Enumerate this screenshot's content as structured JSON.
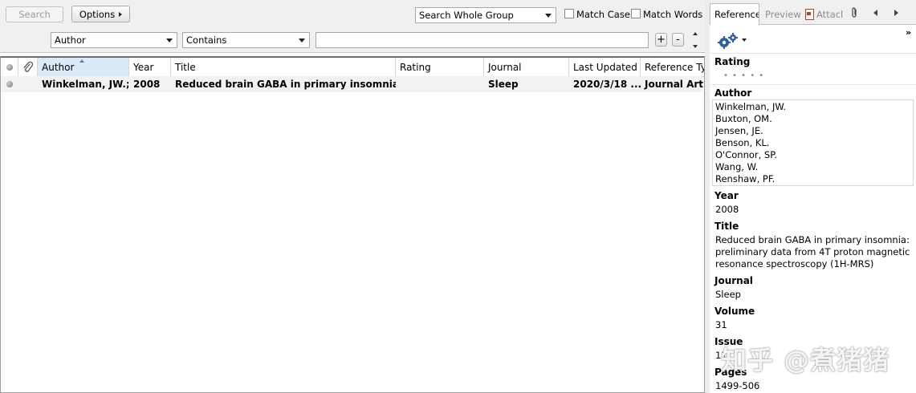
{
  "search": {
    "search_button": "Search",
    "options_button": "Options",
    "scope": "Search Whole Group",
    "match_case": "Match Case",
    "match_words": "Match Words",
    "field": "Author",
    "operator": "Contains",
    "query": "",
    "add_symbol": "+",
    "remove_symbol": "-"
  },
  "list": {
    "columns": [
      "Author",
      "Year",
      "Title",
      "Rating",
      "Journal",
      "Last Updated",
      "Reference Typ"
    ],
    "rows": [
      {
        "author": "Winkelman, JW.;...",
        "year": "2008",
        "title": "Reduced brain GABA in primary insomnia: preli...",
        "rating": "",
        "journal": "Sleep",
        "last_updated": "2020/3/18 ...",
        "ref_type": "Journal Articl"
      }
    ]
  },
  "panel": {
    "tabs": [
      "Reference",
      "Preview",
      "Attacl"
    ],
    "fields": {
      "rating_label": "Rating",
      "rating_dots": "•   •   •   •   •",
      "author_label": "Author",
      "authors": [
        "Winkelman, JW.",
        "Buxton, OM.",
        "Jensen, JE.",
        "Benson, KL.",
        "O'Connor, SP.",
        "Wang, W.",
        "Renshaw, PF."
      ],
      "year_label": "Year",
      "year": "2008",
      "title_label": "Title",
      "title_lines": [
        "Reduced brain GABA in primary insomnia:",
        "preliminary data from 4T proton magnetic",
        "resonance spectroscopy (1H-MRS)"
      ],
      "journal_label": "Journal",
      "journal": "Sleep",
      "volume_label": "Volume",
      "volume": "31",
      "issue_label": "Issue",
      "issue": "11",
      "pages_label": "Pages",
      "pages": "1499-506"
    }
  },
  "watermark": "知乎 @煮猪猪"
}
